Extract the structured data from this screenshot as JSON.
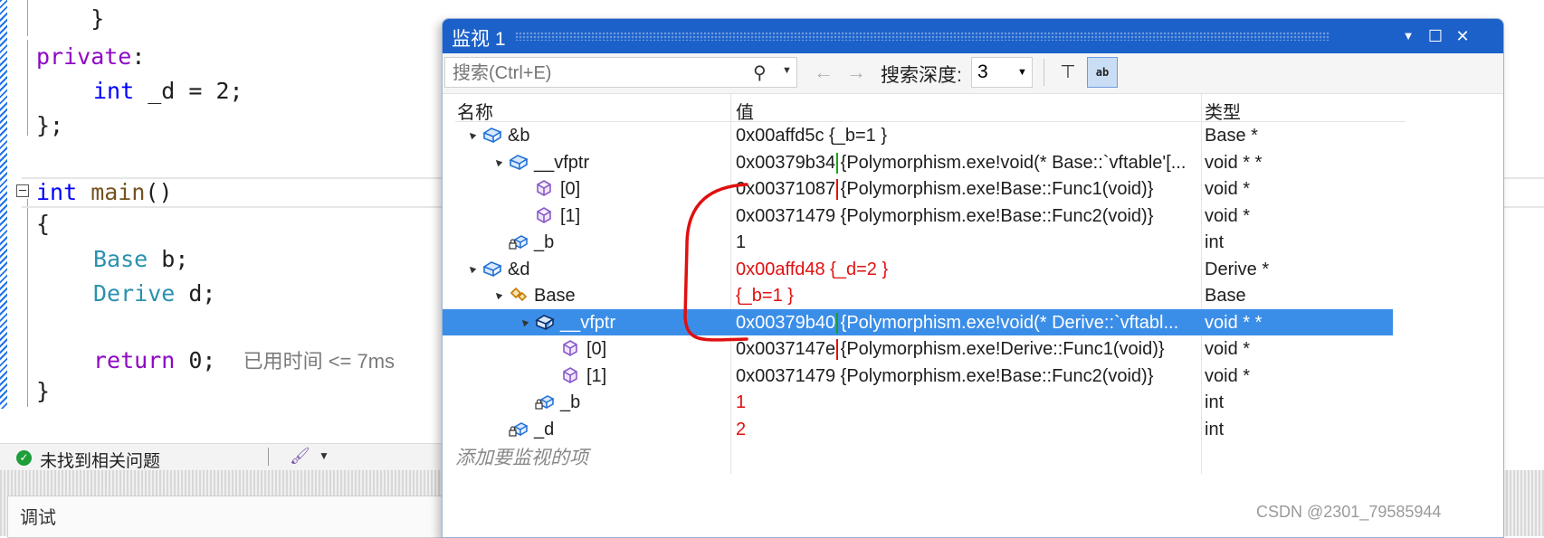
{
  "editor": {
    "lines": [
      {
        "text_top": "    }"
      },
      {
        "private": "private",
        "colon": ":"
      },
      {
        "int": "int",
        "rest": " _d = 2;"
      },
      {
        "close": "};"
      },
      {
        "int": "int",
        "main": " main",
        "paren": "()"
      },
      {
        "brace": "{"
      },
      {
        "type": "Base",
        "rest": " b;"
      },
      {
        "type": "Derive",
        "rest": " d;"
      },
      {
        "ret": "return",
        "rest": " 0;",
        "hint": "已用时间 <= 7ms"
      },
      {
        "brace": "}"
      }
    ]
  },
  "status_bar": {
    "message": "未找到相关问题"
  },
  "bottom_panel": {
    "label": "调试"
  },
  "watch": {
    "title": "监视 1",
    "search_placeholder": "搜索(Ctrl+E)",
    "depth_label": "搜索深度:",
    "depth_value": "3",
    "columns": {
      "name": "名称",
      "value": "值",
      "type": "类型"
    },
    "rows": [
      {
        "name": "&b",
        "value_addr": "0x00affd5c",
        "value_rest": " {_b=1 }",
        "type": "Base *",
        "icon": "object-icon",
        "expander": "▲"
      },
      {
        "name": "__vfptr",
        "value_addr": "0x00379b34",
        "value_rest": " {Polymorphism.exe!void(* Base::`vftable'[...",
        "type": "void * *",
        "icon": "object-icon",
        "expander": "▲"
      },
      {
        "name": "[0]",
        "value_addr": "0x00371087",
        "value_rest": " {Polymorphism.exe!Base::Func1(void)}",
        "type": "void *",
        "icon": "cube-icon",
        "expander": ""
      },
      {
        "name": "[1]",
        "value_addr": "0x00371479",
        "value_rest": " {Polymorphism.exe!Base::Func2(void)}",
        "type": "void *",
        "icon": "cube-icon",
        "expander": ""
      },
      {
        "name": "_b",
        "value_addr": "1",
        "value_rest": "",
        "type": "int",
        "icon": "private-field-icon",
        "expander": ""
      },
      {
        "name": "&d",
        "value_addr": "0x00affd48",
        "value_rest": " {_d=2 }",
        "type": "Derive *",
        "icon": "object-icon",
        "expander": "▲"
      },
      {
        "name": "Base",
        "value_addr": "{_b=1 }",
        "value_rest": "",
        "type": "Base",
        "icon": "base-class-icon",
        "expander": "▲"
      },
      {
        "name": "__vfptr",
        "value_addr": "0x00379b40",
        "value_rest": " {Polymorphism.exe!void(* Derive::`vftabl...",
        "type": "void * *",
        "icon": "object-icon",
        "expander": "▲"
      },
      {
        "name": "[0]",
        "value_addr": "0x0037147e",
        "value_rest": " {Polymorphism.exe!Derive::Func1(void)}",
        "type": "void *",
        "icon": "cube-icon",
        "expander": ""
      },
      {
        "name": "[1]",
        "value_addr": "0x00371479",
        "value_rest": " {Polymorphism.exe!Base::Func2(void)}",
        "type": "void *",
        "icon": "cube-icon",
        "expander": ""
      },
      {
        "name": "_b",
        "value_addr": "1",
        "value_rest": "",
        "type": "int",
        "icon": "private-field-icon",
        "expander": ""
      },
      {
        "name": "_d",
        "value_addr": "2",
        "value_rest": "",
        "type": "int",
        "icon": "private-field-icon",
        "expander": ""
      }
    ],
    "add_item": "添加要监视的项"
  },
  "watermark": "CSDN @2301_79585944",
  "colors": {
    "accent": "#1c61c9",
    "selection": "#3b8ee8",
    "changed": "#e01010",
    "green_box": "#1ca21c"
  }
}
